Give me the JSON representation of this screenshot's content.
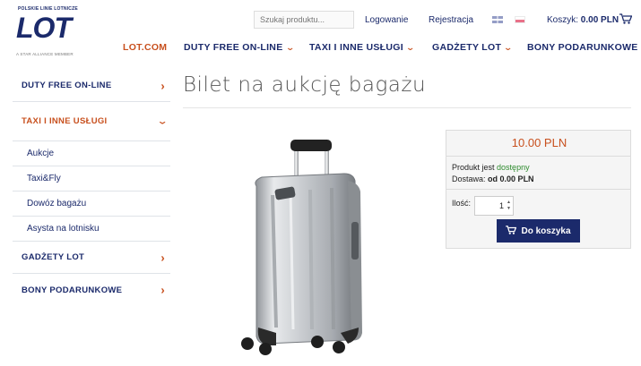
{
  "header": {
    "logo_tagline_top": "POLSKIE LINIE LOTNICZE",
    "logo_wordmark": "LOT",
    "logo_tagline_bottom": "A STAR ALLIANCE MEMBER",
    "search_placeholder": "Szukaj produktu...",
    "login_label": "Logowanie",
    "register_label": "Rejestracja",
    "languages": [
      "en-flag-icon",
      "pl-flag-icon"
    ],
    "cart_label": "Koszyk:",
    "cart_total": "0.00 PLN"
  },
  "nav": {
    "items": [
      {
        "label": "LOT.COM"
      },
      {
        "label": "DUTY FREE ON-LINE"
      },
      {
        "label": "TAXI I INNE USŁUGI"
      },
      {
        "label": "GADŻETY LOT"
      },
      {
        "label": "BONY PODARUNKOWE"
      }
    ]
  },
  "sidebar": {
    "items": [
      {
        "label": "DUTY FREE ON-LINE"
      },
      {
        "label": "TAXI I INNE USŁUGI"
      },
      {
        "label": "Aukcje"
      },
      {
        "label": "Taxi&Fly"
      },
      {
        "label": "Dowóz bagażu"
      },
      {
        "label": "Asysta na lotnisku"
      },
      {
        "label": "GADŻETY LOT"
      },
      {
        "label": "BONY PODARUNKOWE"
      }
    ]
  },
  "product": {
    "title": "Bilet na aukcję bagażu",
    "price": "10.00 PLN",
    "availability_label": "Produkt jest",
    "availability_value": "dostępny",
    "shipping_label": "Dostawa:",
    "shipping_value": "od 0.00 PLN",
    "qty_label": "Ilość:",
    "qty_value": "1",
    "add_to_cart_label": "Do koszyka"
  },
  "colors": {
    "brand_navy": "#1b2a6b",
    "accent_orange": "#c8501e",
    "available_green": "#2e8b2e"
  }
}
